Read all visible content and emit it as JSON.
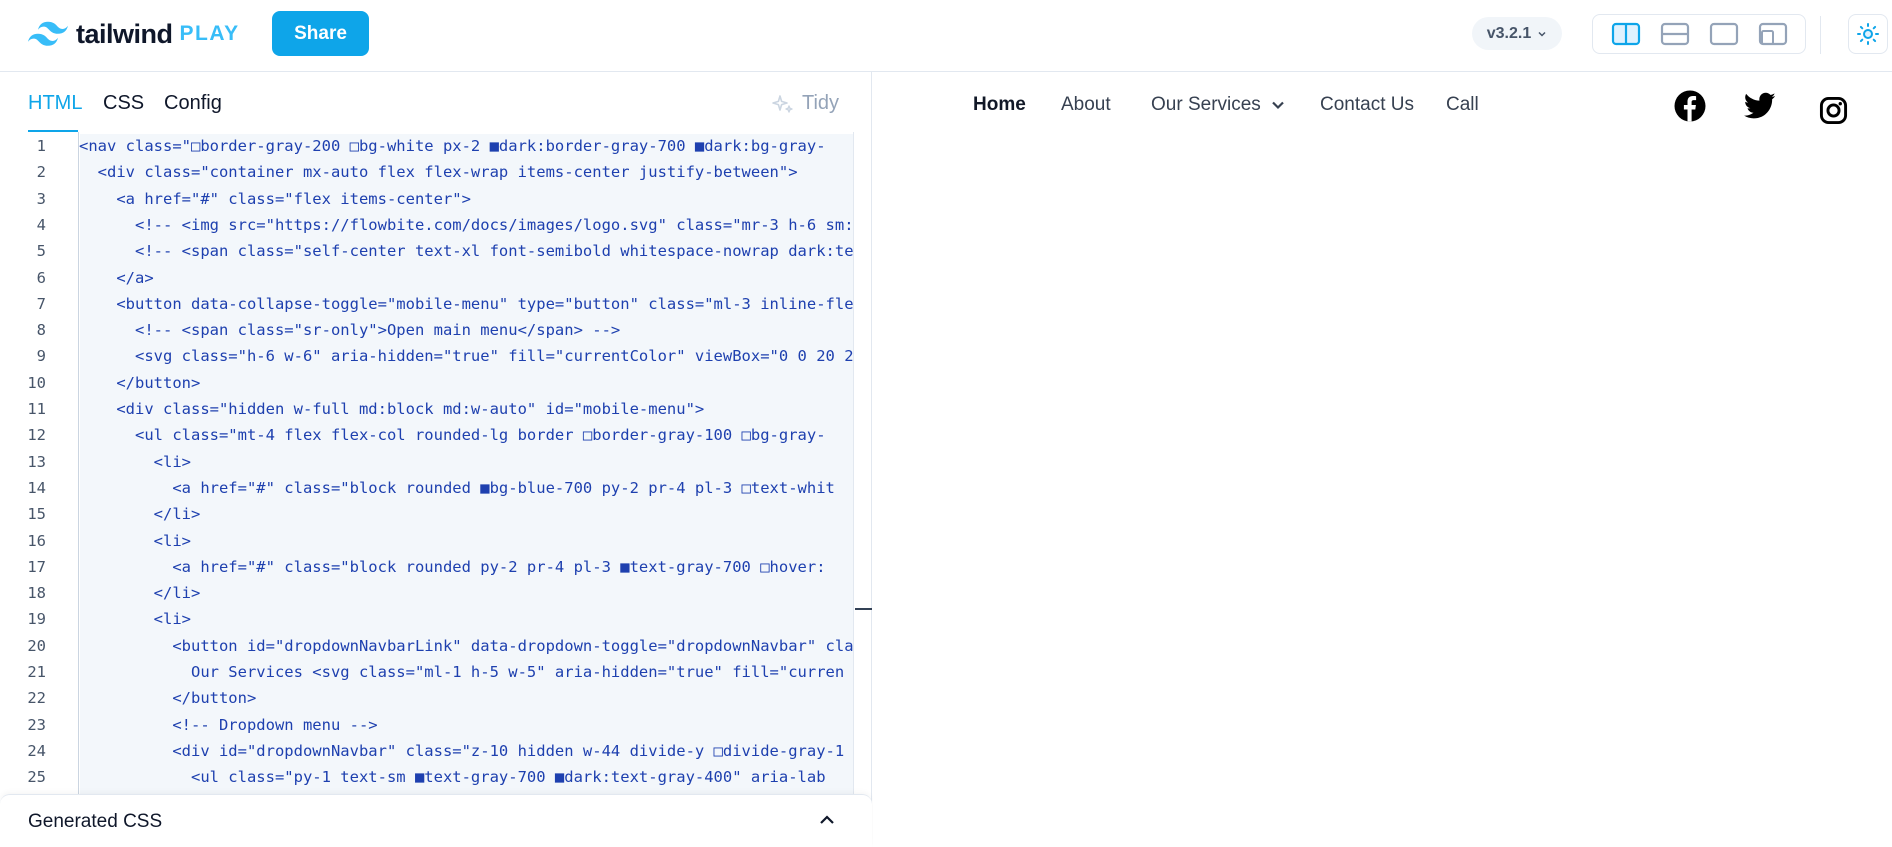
{
  "header": {
    "logo_text": "tailwind",
    "logo_suffix": "PLAY",
    "share_label": "Share",
    "version_label": "v3.2.1",
    "layout_buttons": [
      "layout-vertical-icon",
      "layout-horizontal-icon",
      "layout-preview-icon",
      "layout-responsive-icon"
    ],
    "theme_icon": "sun-icon"
  },
  "editor": {
    "tabs": [
      "HTML",
      "CSS",
      "Config"
    ],
    "active_tab": "HTML",
    "tidy_label": "Tidy",
    "lines": [
      "<nav class=\"□border-gray-200 □bg-white px-2 ■dark:border-gray-700 ■dark:bg-gray-",
      "  <div class=\"container mx-auto flex flex-wrap items-center justify-between\">",
      "    <a href=\"#\" class=\"flex items-center\">",
      "      <!-- <img src=\"https://flowbite.com/docs/images/logo.svg\" class=\"mr-3 h-6 sm:",
      "      <!-- <span class=\"self-center text-xl font-semibold whitespace-nowrap dark:te",
      "    </a>",
      "    <button data-collapse-toggle=\"mobile-menu\" type=\"button\" class=\"ml-3 inline-fle",
      "      <!-- <span class=\"sr-only\">Open main menu</span> -->",
      "      <svg class=\"h-6 w-6\" aria-hidden=\"true\" fill=\"currentColor\" viewBox=\"0 0 20 2",
      "    </button>",
      "    <div class=\"hidden w-full md:block md:w-auto\" id=\"mobile-menu\">",
      "      <ul class=\"mt-4 flex flex-col rounded-lg border □border-gray-100 □bg-gray-",
      "        <li>",
      "          <a href=\"#\" class=\"block rounded ■bg-blue-700 py-2 pr-4 pl-3 □text-whit",
      "        </li>",
      "        <li>",
      "          <a href=\"#\" class=\"block rounded py-2 pr-4 pl-3 ■text-gray-700 □hover:",
      "        </li>",
      "        <li>",
      "          <button id=\"dropdownNavbarLink\" data-dropdown-toggle=\"dropdownNavbar\" cla",
      "            Our Services <svg class=\"ml-1 h-5 w-5\" aria-hidden=\"true\" fill=\"curren",
      "          </button>",
      "          <!-- Dropdown menu -->",
      "          <div id=\"dropdownNavbar\" class=\"z-10 hidden w-44 divide-y □divide-gray-1",
      "            <ul class=\"py-1 text-sm ■text-gray-700 ■dark:text-gray-400\" aria-lab"
    ],
    "generated_css_label": "Generated CSS"
  },
  "preview": {
    "nav_items": [
      "Home",
      "About",
      "Our Services",
      "Contact Us",
      "Call"
    ],
    "social_icons": [
      "facebook-icon",
      "twitter-icon",
      "instagram-icon"
    ]
  },
  "colors": {
    "accent": "#0ea5e9",
    "logo_play": "#38bdf8"
  }
}
